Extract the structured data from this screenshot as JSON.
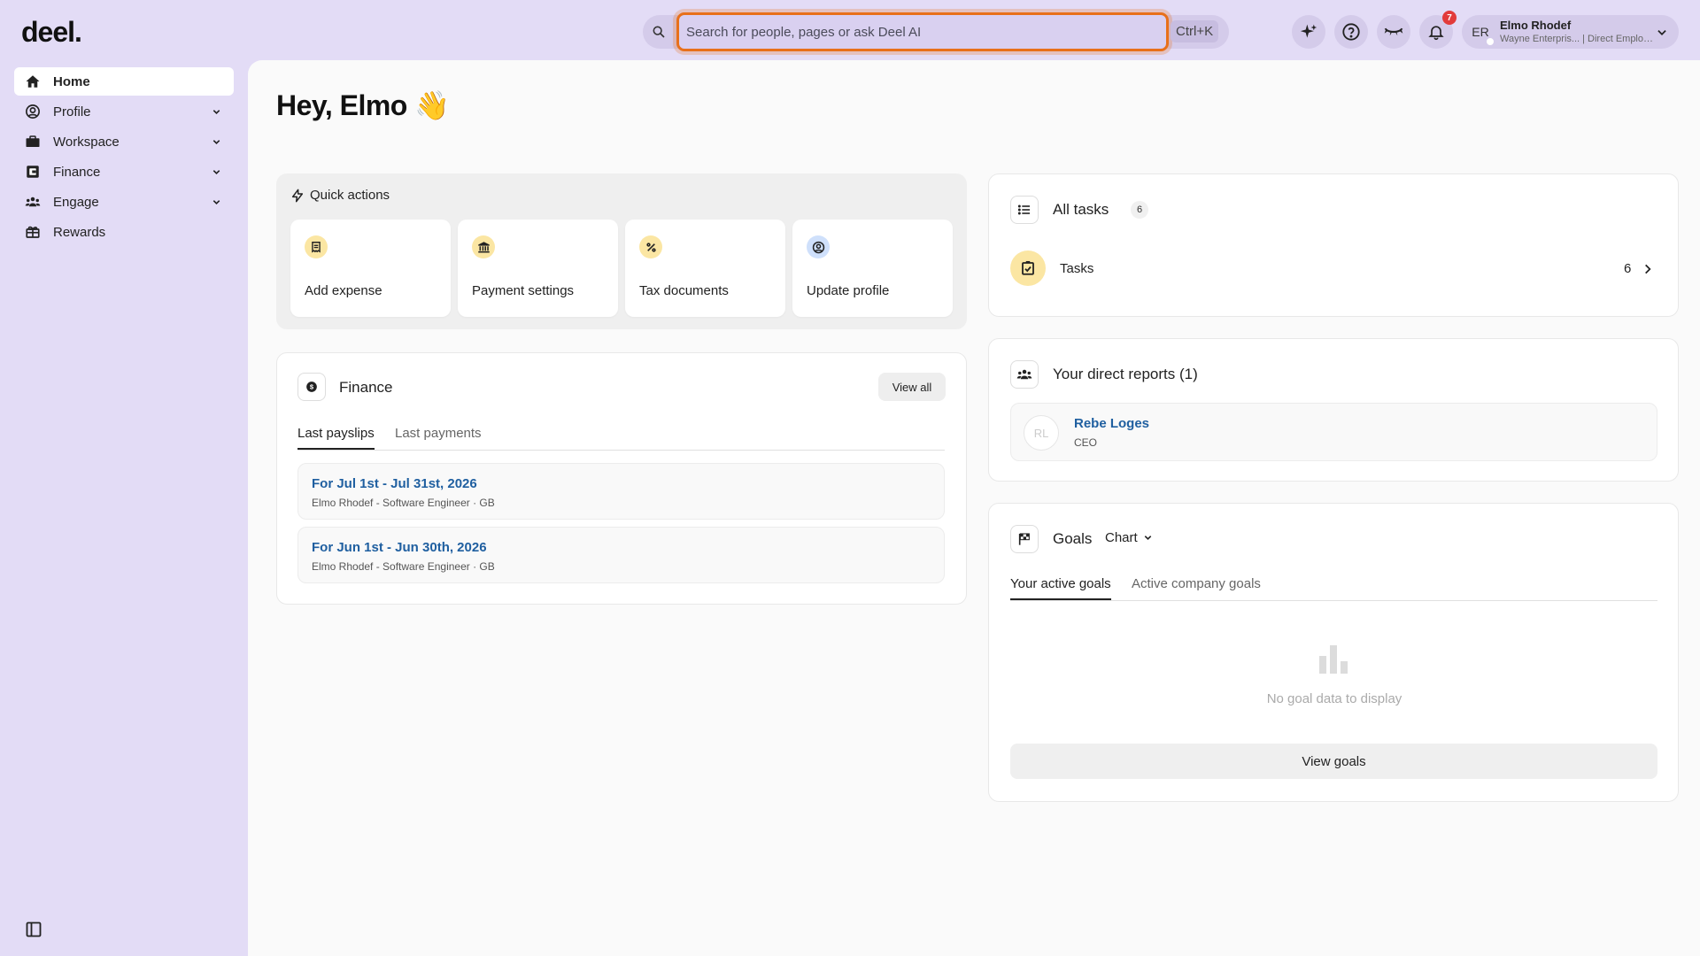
{
  "app": {
    "logo": "deel."
  },
  "search": {
    "placeholder": "Search for people, pages or ask Deel AI",
    "shortcut": "Ctrl+K"
  },
  "topbar": {
    "notification_count": "7"
  },
  "user": {
    "initials": "ER",
    "name": "Elmo Rhodef",
    "subtitle": "Wayne Enterpris... | Direct Employ..."
  },
  "sidebar": {
    "items": [
      {
        "label": "Home"
      },
      {
        "label": "Profile"
      },
      {
        "label": "Workspace"
      },
      {
        "label": "Finance"
      },
      {
        "label": "Engage"
      },
      {
        "label": "Rewards"
      }
    ]
  },
  "greeting": {
    "text": "Hey, Elmo",
    "emoji": "👋"
  },
  "quick_actions": {
    "title": "Quick actions",
    "items": [
      {
        "label": "Add expense"
      },
      {
        "label": "Payment settings"
      },
      {
        "label": "Tax documents"
      },
      {
        "label": "Update profile"
      }
    ]
  },
  "finance": {
    "title": "Finance",
    "view_all": "View all",
    "tabs": [
      "Last payslips",
      "Last payments"
    ],
    "payslips": [
      {
        "title": "For Jul 1st - Jul 31st, 2026",
        "subtitle": "Elmo Rhodef - Software Engineer · GB"
      },
      {
        "title": "For Jun 1st - Jun 30th, 2026",
        "subtitle": "Elmo Rhodef - Software Engineer · GB"
      }
    ]
  },
  "tasks": {
    "title": "All tasks",
    "count": "6",
    "row_label": "Tasks",
    "row_count": "6"
  },
  "reports": {
    "title": "Your direct reports (1)",
    "people": [
      {
        "initials": "RL",
        "name": "Rebe Loges",
        "role": "CEO"
      }
    ]
  },
  "goals": {
    "title": "Goals",
    "view_mode": "Chart",
    "tabs": [
      "Your active goals",
      "Active company goals"
    ],
    "empty_text": "No goal data to display",
    "view_button": "View goals"
  },
  "colors": {
    "brand_bg": "#e3dcf6",
    "focus_ring": "#e8701a",
    "link": "#1f5fa0",
    "badge": "#e23b3b"
  }
}
